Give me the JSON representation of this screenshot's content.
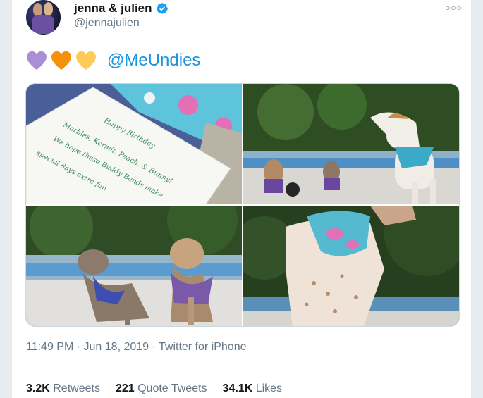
{
  "author": {
    "display_name": "jenna & julien",
    "handle": "@jennajulien",
    "avatar_icon": "profile-avatar",
    "verified_icon": "verified-badge-icon"
  },
  "tweet": {
    "emojis": [
      "purple-heart-icon",
      "orange-heart-icon",
      "yellow-heart-icon"
    ],
    "mention": "@MeUndies",
    "media": [
      {
        "subject": "birthday card",
        "card_text": [
          "Happy Birthday",
          "Marbles, Kermit, Peach, & Bunny!",
          "We hope these Buddy Bands make",
          "special days extra fun"
        ]
      },
      {
        "subject": "greyhound by pool"
      },
      {
        "subject": "two italian greyhounds"
      },
      {
        "subject": "greyhound closeup"
      }
    ],
    "time": "11:49 PM",
    "date": "Jun 18, 2019",
    "source": "Twitter for iPhone",
    "separator": "·"
  },
  "stats": {
    "retweets_count": "3.2K",
    "retweets_label": "Retweets",
    "quotes_count": "221",
    "quotes_label": "Quote Tweets",
    "likes_count": "34.1K",
    "likes_label": "Likes"
  },
  "colors": {
    "accent": "#1b95e0",
    "muted": "#657786",
    "verified": "#1da1f2"
  }
}
